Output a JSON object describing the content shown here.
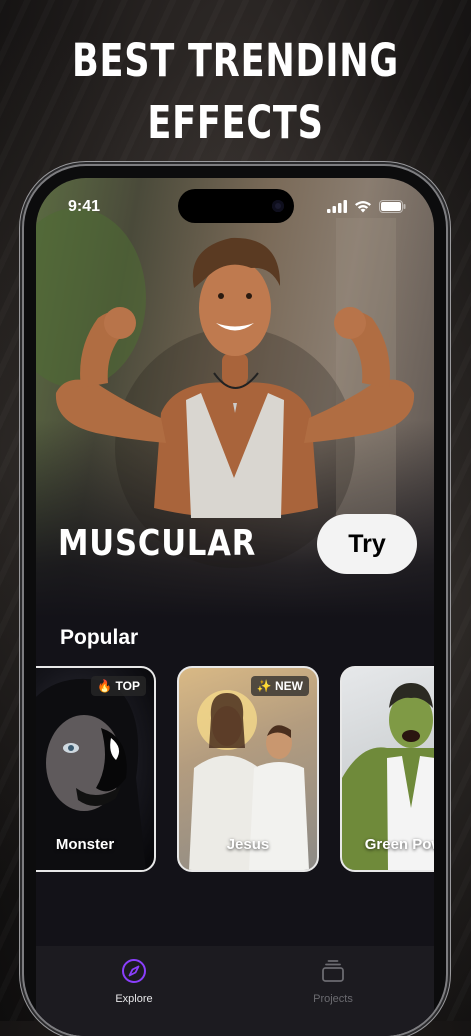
{
  "headline": {
    "line1": "BEST TRENDING",
    "line2": "EFFECTS"
  },
  "status_bar": {
    "time": "9:41"
  },
  "hero": {
    "effect_name": "MUSCULAR",
    "try_label": "Try"
  },
  "popular": {
    "title": "Popular",
    "cards": [
      {
        "name": "Monster",
        "badge": "🔥 TOP"
      },
      {
        "name": "Jesus",
        "badge": "✨ NEW"
      },
      {
        "name": "Green Power",
        "badge": ""
      }
    ]
  },
  "tabbar": {
    "tabs": [
      {
        "label": "Explore",
        "icon": "compass-icon",
        "active": true
      },
      {
        "label": "Projects",
        "icon": "stack-icon",
        "active": false
      }
    ]
  },
  "colors": {
    "accent": "#8a3ffc",
    "tab_inactive": "#6b6b70",
    "card_border": "#e8e8e8"
  }
}
